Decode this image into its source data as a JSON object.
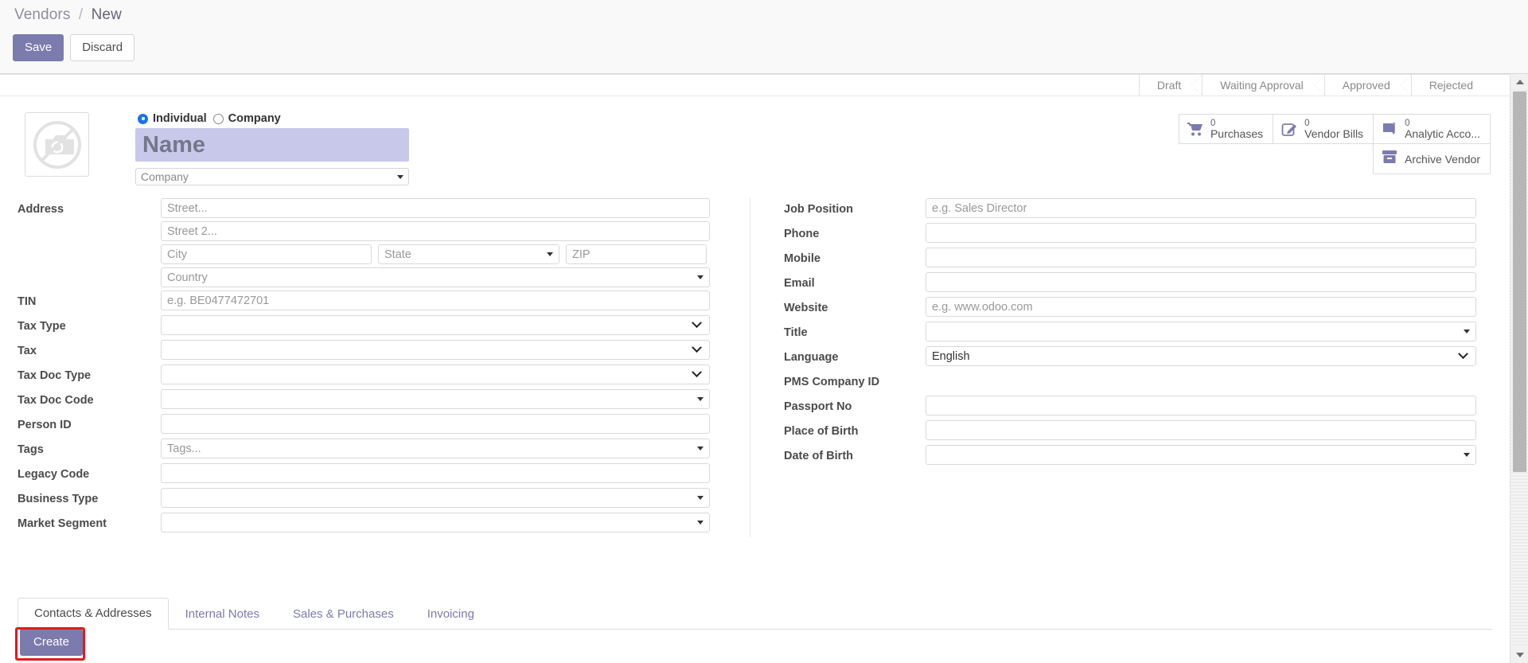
{
  "breadcrumb": {
    "root": "Vendors",
    "separator": "/",
    "current": "New"
  },
  "control_panel": {
    "save_label": "Save",
    "discard_label": "Discard"
  },
  "statusbar": {
    "steps": [
      {
        "label": "Draft"
      },
      {
        "label": "Waiting Approval"
      },
      {
        "label": "Approved"
      },
      {
        "label": "Rejected"
      }
    ]
  },
  "header": {
    "avatar_icon": "no-camera-icon",
    "partner_type": {
      "individual_label": "Individual",
      "company_label": "Company",
      "selected": "Individual"
    },
    "name": {
      "value": "",
      "placeholder": "Name"
    },
    "company": {
      "value": "",
      "placeholder": "Company"
    }
  },
  "stat_buttons": [
    {
      "icon": "shopping-cart-icon",
      "value": "0",
      "label": "Purchases"
    },
    {
      "icon": "pencil-square-icon",
      "value": "0",
      "label": "Vendor Bills"
    },
    {
      "icon": "book-icon",
      "value": "0",
      "label": "Analytic Acco..."
    }
  ],
  "archive_button": {
    "icon": "archive-box-icon",
    "label": "Archive Vendor"
  },
  "left_column": {
    "address": {
      "label": "Address",
      "street": {
        "placeholder": "Street...",
        "value": ""
      },
      "street2": {
        "placeholder": "Street 2...",
        "value": ""
      },
      "city": {
        "placeholder": "City",
        "value": ""
      },
      "state": {
        "placeholder": "State",
        "value": ""
      },
      "zip": {
        "placeholder": "ZIP",
        "value": ""
      },
      "country": {
        "placeholder": "Country",
        "value": ""
      }
    },
    "tin": {
      "label": "TIN",
      "placeholder": "e.g. BE0477472701",
      "value": ""
    },
    "tax_type": {
      "label": "Tax Type",
      "value": ""
    },
    "tax": {
      "label": "Tax",
      "value": ""
    },
    "tax_doc_type": {
      "label": "Tax Doc Type",
      "value": ""
    },
    "tax_doc_code": {
      "label": "Tax Doc Code",
      "value": ""
    },
    "person_id": {
      "label": "Person ID",
      "value": ""
    },
    "tags": {
      "label": "Tags",
      "placeholder": "Tags...",
      "value": ""
    },
    "legacy_code": {
      "label": "Legacy Code",
      "value": ""
    },
    "business_type": {
      "label": "Business Type",
      "value": ""
    },
    "market_segment": {
      "label": "Market Segment",
      "value": ""
    }
  },
  "right_column": {
    "job_position": {
      "label": "Job Position",
      "placeholder": "e.g. Sales Director",
      "value": ""
    },
    "phone": {
      "label": "Phone",
      "value": ""
    },
    "mobile": {
      "label": "Mobile",
      "value": ""
    },
    "email": {
      "label": "Email",
      "value": ""
    },
    "website": {
      "label": "Website",
      "placeholder": "e.g. www.odoo.com",
      "value": ""
    },
    "title": {
      "label": "Title",
      "value": ""
    },
    "language": {
      "label": "Language",
      "value": "English"
    },
    "pms_company_id": {
      "label": "PMS Company ID",
      "value": ""
    },
    "passport_no": {
      "label": "Passport No",
      "value": ""
    },
    "place_of_birth": {
      "label": "Place of Birth",
      "value": ""
    },
    "date_of_birth": {
      "label": "Date of Birth",
      "value": ""
    }
  },
  "notebook": {
    "tabs": [
      {
        "label": "Contacts & Addresses",
        "active": true
      },
      {
        "label": "Internal Notes",
        "active": false
      },
      {
        "label": "Sales & Purchases",
        "active": false
      },
      {
        "label": "Invoicing",
        "active": false
      }
    ],
    "create_label": "Create"
  },
  "colors": {
    "accent_purple": "#7c7bad",
    "required_field_bg": "#c8c8ea",
    "highlight_red": "#e01b1b",
    "label_text": "#4b4b4b"
  }
}
